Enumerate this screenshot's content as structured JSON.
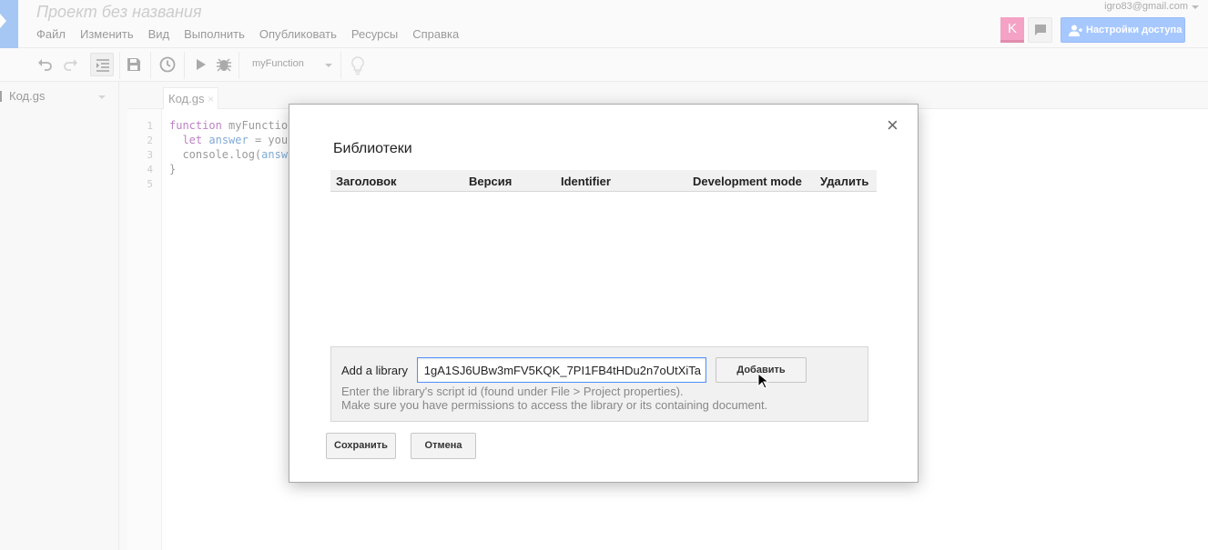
{
  "header": {
    "project_title": "Проект без названия",
    "account_email": "igro83@gmail.com",
    "avatar_letter": "K",
    "share_label": "Настройки доступа",
    "menu": [
      "Файл",
      "Изменить",
      "Вид",
      "Выполнить",
      "Опубликовать",
      "Ресурсы",
      "Справка"
    ]
  },
  "toolbar": {
    "function_select": "myFunction"
  },
  "files": {
    "current": "Код.gs"
  },
  "editor": {
    "tab_label": "Код.gs",
    "tab_close": "×",
    "line_numbers": [
      "1",
      "2",
      "3",
      "4",
      "5"
    ]
  },
  "dialog": {
    "title": "Библиотеки",
    "close": "×",
    "columns": {
      "title": "Заголовок",
      "version": "Версия",
      "identifier": "Identifier",
      "dev_mode": "Development mode",
      "delete": "Удалить"
    },
    "add_label": "Add a library",
    "add_input_value": "1gA1SJ6UBw3mFV5KQK_7PI1FB4tHDu2n7oUtXiTa",
    "add_button": "Добавить",
    "hint_line1": "Enter the library's script id (found under File > Project properties).",
    "hint_line2": "Make sure you have permissions to access the library or its containing document.",
    "save_button": "Сохранить",
    "cancel_button": "Отмена"
  },
  "colors": {
    "accent": "#4d90fe",
    "avatar": "#e8458a",
    "logo": "#4d8ee6"
  }
}
